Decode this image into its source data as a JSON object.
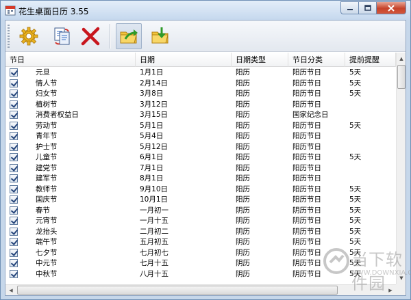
{
  "window": {
    "title": "花生桌面日历 3.55"
  },
  "toolbar": {
    "buttons": [
      {
        "name": "settings-button",
        "icon": "gear-icon"
      },
      {
        "name": "copy-button",
        "icon": "copy-document-icon"
      },
      {
        "name": "delete-button",
        "icon": "red-x-icon"
      },
      {
        "name": "export-button",
        "icon": "folder-arrow-out-icon"
      },
      {
        "name": "import-button",
        "icon": "folder-arrow-in-icon"
      }
    ]
  },
  "list": {
    "columns": [
      "节日",
      "日期",
      "日期类型",
      "节日分类",
      "提前提醒"
    ],
    "rows": [
      {
        "checked": true,
        "name": "元旦",
        "date": "1月1日",
        "type": "阳历",
        "category": "阳历节日",
        "remind": "5天"
      },
      {
        "checked": true,
        "name": "情人节",
        "date": "2月14日",
        "type": "阳历",
        "category": "阳历节日",
        "remind": "5天"
      },
      {
        "checked": true,
        "name": "妇女节",
        "date": "3月8日",
        "type": "阳历",
        "category": "阳历节日",
        "remind": "5天"
      },
      {
        "checked": true,
        "name": "植树节",
        "date": "3月12日",
        "type": "阳历",
        "category": "阳历节日",
        "remind": ""
      },
      {
        "checked": true,
        "name": "消费者权益日",
        "date": "3月15日",
        "type": "阳历",
        "category": "国家纪念日",
        "remind": ""
      },
      {
        "checked": true,
        "name": "劳动节",
        "date": "5月1日",
        "type": "阳历",
        "category": "阳历节日",
        "remind": "5天"
      },
      {
        "checked": true,
        "name": "青年节",
        "date": "5月4日",
        "type": "阳历",
        "category": "阳历节日",
        "remind": ""
      },
      {
        "checked": true,
        "name": "护士节",
        "date": "5月12日",
        "type": "阳历",
        "category": "阳历节日",
        "remind": ""
      },
      {
        "checked": true,
        "name": "儿童节",
        "date": "6月1日",
        "type": "阳历",
        "category": "阳历节日",
        "remind": "5天"
      },
      {
        "checked": true,
        "name": "建党节",
        "date": "7月1日",
        "type": "阳历",
        "category": "阳历节日",
        "remind": ""
      },
      {
        "checked": true,
        "name": "建军节",
        "date": "8月1日",
        "type": "阳历",
        "category": "阳历节日",
        "remind": ""
      },
      {
        "checked": true,
        "name": "教师节",
        "date": "9月10日",
        "type": "阳历",
        "category": "阳历节日",
        "remind": "5天"
      },
      {
        "checked": true,
        "name": "国庆节",
        "date": "10月1日",
        "type": "阳历",
        "category": "阳历节日",
        "remind": "5天"
      },
      {
        "checked": true,
        "name": "春节",
        "date": "一月初一",
        "type": "阴历",
        "category": "阴历节日",
        "remind": "5天"
      },
      {
        "checked": true,
        "name": "元宵节",
        "date": "一月十五",
        "type": "阴历",
        "category": "阴历节日",
        "remind": "5天"
      },
      {
        "checked": true,
        "name": "龙抬头",
        "date": "二月初二",
        "type": "阴历",
        "category": "阴历节日",
        "remind": "5天"
      },
      {
        "checked": true,
        "name": "端午节",
        "date": "五月初五",
        "type": "阴历",
        "category": "阴历节日",
        "remind": "5天"
      },
      {
        "checked": true,
        "name": "七夕节",
        "date": "七月初七",
        "type": "阴历",
        "category": "阴历节日",
        "remind": "5天"
      },
      {
        "checked": true,
        "name": "中元节",
        "date": "七月十五",
        "type": "阴历",
        "category": "阴历节日",
        "remind": "5天"
      },
      {
        "checked": true,
        "name": "中秋节",
        "date": "八月十五",
        "type": "阴历",
        "category": "阴历节日",
        "remind": "5天"
      }
    ]
  },
  "watermark": {
    "text": "当下软件园",
    "url": "WWW.DOWNXIA.COM"
  },
  "colors": {
    "title_bar": "#c5d8ee",
    "close_button": "#c6432a",
    "check": "#24447a"
  }
}
